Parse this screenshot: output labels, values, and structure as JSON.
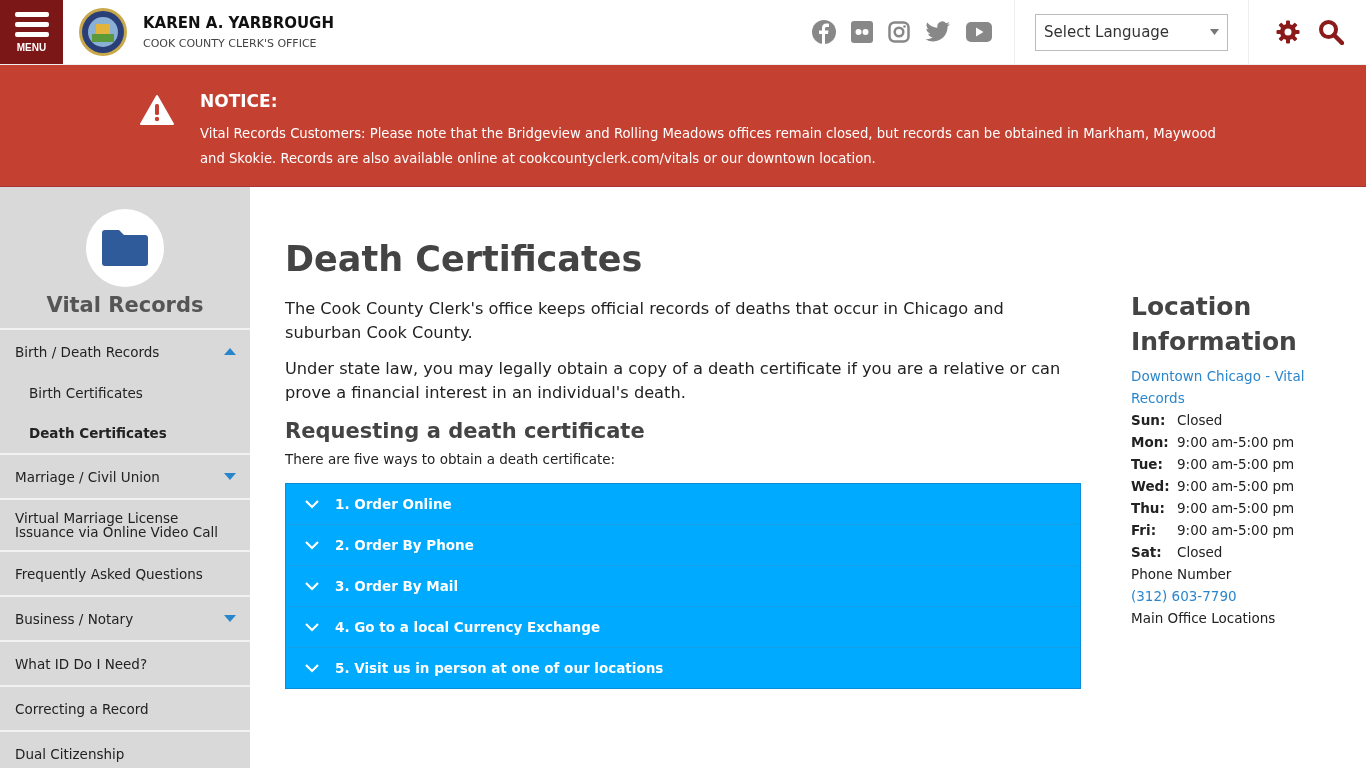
{
  "header": {
    "menu_label": "MENU",
    "title": "KAREN A. YARBROUGH",
    "subtitle": "COOK COUNTY CLERK'S OFFICE",
    "language_select": {
      "value": "Select Language"
    }
  },
  "notice": {
    "title": "NOTICE:",
    "text": "Vital Records Customers: Please note that the Bridgeview and Rolling Meadows offices remain closed, but records can be obtained in Markham, Maywood and Skokie. Records are also available online at cookcountyclerk.com/vitals or our downtown location."
  },
  "sidebar": {
    "title": "Vital Records",
    "items": [
      {
        "label": "Birth / Death Records",
        "kind": "group",
        "expanded": true,
        "children": [
          {
            "label": "Birth Certificates",
            "selected": false
          },
          {
            "label": "Death Certificates",
            "selected": true
          }
        ]
      },
      {
        "label": "Marriage / Civil Union",
        "kind": "group",
        "expanded": false
      },
      {
        "label": "Virtual Marriage License Issuance via Online Video Call",
        "kind": "link"
      },
      {
        "label": "Frequently Asked Questions",
        "kind": "link"
      },
      {
        "label": "Business / Notary",
        "kind": "group",
        "expanded": false
      },
      {
        "label": "What ID Do I Need?",
        "kind": "link"
      },
      {
        "label": "Correcting a Record",
        "kind": "link"
      },
      {
        "label": "Dual Citizenship",
        "kind": "link"
      }
    ]
  },
  "main": {
    "title": "Death Certificates",
    "paragraphs": [
      "The Cook County Clerk's office keeps official records of deaths that occur in Chicago and suburban Cook County.",
      "Under state law, you may legally obtain a copy of a death certificate if you are a relative or can prove a financial interest in an individual's death."
    ],
    "subheading": "Requesting a death certificate",
    "intro": "There are five ways to obtain a death certificate:",
    "accordion": [
      {
        "label": "1. Order Online",
        "expanded": false
      },
      {
        "label": "2. Order By Phone",
        "expanded": false
      },
      {
        "label": "3. Order By Mail",
        "expanded": false
      },
      {
        "label": "4. Go to a local Currency Exchange",
        "expanded": false
      },
      {
        "label": "5. Visit us in person at one of our locations",
        "expanded": false
      }
    ]
  },
  "location": {
    "title": "Location Information",
    "link": "Downtown Chicago - Vital Records",
    "hours": [
      {
        "day": "Sun:",
        "time": "Closed"
      },
      {
        "day": "Mon:",
        "time": "9:00 am-5:00 pm"
      },
      {
        "day": "Tue:",
        "time": "9:00 am-5:00 pm"
      },
      {
        "day": "Wed:",
        "time": "9:00 am-5:00 pm"
      },
      {
        "day": "Thu:",
        "time": "9:00 am-5:00 pm"
      },
      {
        "day": "Fri:",
        "time": "9:00 am-5:00 pm"
      },
      {
        "day": "Sat:",
        "time": "Closed"
      }
    ],
    "phone_label": "Phone Number",
    "phone": "(312) 603-7790",
    "offices_label": "Main Office Locations"
  }
}
